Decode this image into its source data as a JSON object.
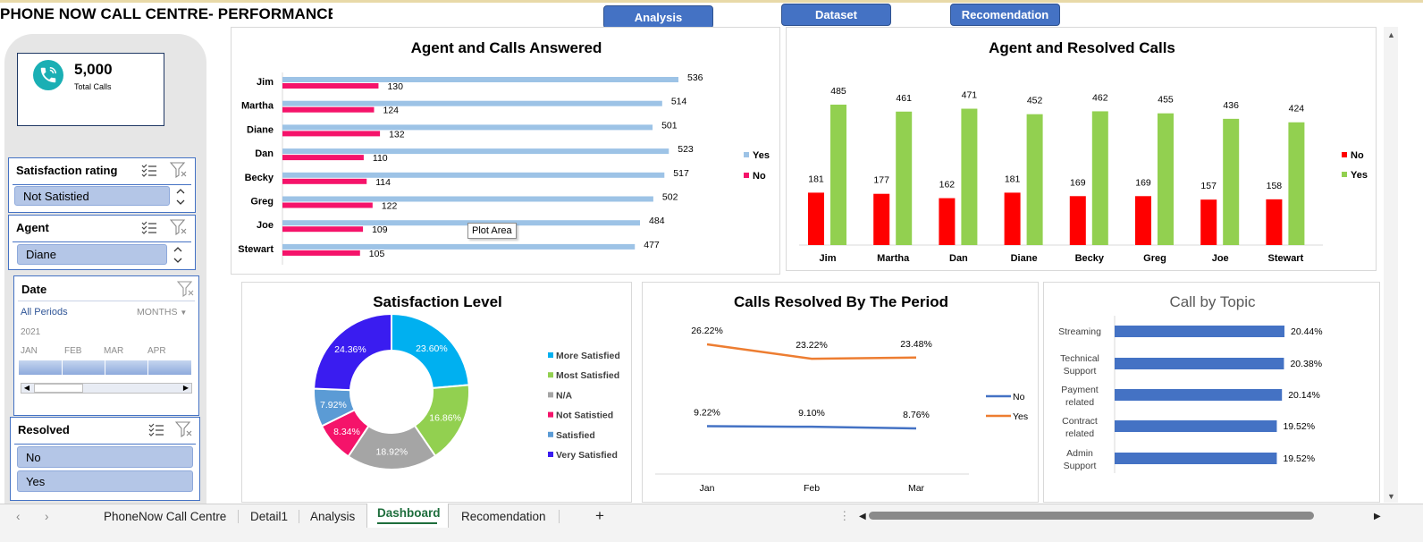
{
  "header": {
    "title": "PHONE NOW CALL CENTRE- PERFORMANCE DAS",
    "nav": {
      "analysis": "Analysis",
      "dataset": "Dataset",
      "recomendation": "Recomendation"
    }
  },
  "kpi": {
    "value": "5,000",
    "label": "Total Calls"
  },
  "slicers": {
    "satisfaction": {
      "title": "Satisfaction rating",
      "selected": "Not Satistied"
    },
    "agent": {
      "title": "Agent",
      "selected": "Diane"
    },
    "date": {
      "title": "Date",
      "period": "All Periods",
      "unit": "MONTHS",
      "year": "2021",
      "months": [
        "JAN",
        "FEB",
        "MAR",
        "APR"
      ]
    },
    "resolved": {
      "title": "Resolved",
      "items": [
        "No",
        "Yes"
      ]
    }
  },
  "tooltip": "Plot Area",
  "colors": {
    "yes_bar": "#9dc3e6",
    "no_bar": "#f5136a",
    "resolved_no": "#ff0000",
    "resolved_yes": "#92d050",
    "line_no": "#4472c4",
    "line_yes": "#ed7d31",
    "topic_bar": "#4472c4",
    "nav_button": "#4472c4"
  },
  "chart_data": [
    {
      "type": "bar",
      "title": "Agent and Calls Answered",
      "categories": [
        "Jim",
        "Martha",
        "Diane",
        "Dan",
        "Becky",
        "Greg",
        "Joe",
        "Stewart"
      ],
      "series": [
        {
          "name": "Yes",
          "values": [
            536,
            514,
            501,
            523,
            517,
            502,
            484,
            477
          ]
        },
        {
          "name": "No",
          "values": [
            130,
            124,
            132,
            110,
            114,
            122,
            109,
            105
          ]
        }
      ],
      "orientation": "horizontal",
      "legend": "right"
    },
    {
      "type": "bar",
      "title": "Agent and Resolved Calls",
      "categories": [
        "Jim",
        "Martha",
        "Dan",
        "Diane",
        "Becky",
        "Greg",
        "Joe",
        "Stewart"
      ],
      "series": [
        {
          "name": "No",
          "values": [
            181,
            177,
            162,
            181,
            169,
            169,
            157,
            158
          ]
        },
        {
          "name": "Yes",
          "values": [
            485,
            461,
            471,
            452,
            462,
            455,
            436,
            424
          ]
        }
      ],
      "orientation": "vertical",
      "legend": "right"
    },
    {
      "type": "pie",
      "title": "Satisfaction Level",
      "donut": true,
      "labels": [
        "More Satisfied",
        "Most Satisfied",
        "N/A",
        "Not Satistied",
        "Satisfied",
        "Very Satisfied"
      ],
      "display": [
        "23.60%",
        "16.86%",
        "18.92%",
        "8.34%",
        "7.92%",
        "24.36%"
      ],
      "values": [
        23.6,
        16.86,
        18.92,
        8.34,
        7.92,
        24.36
      ],
      "colors": [
        "#00b0f0",
        "#92d050",
        "#a5a5a5",
        "#f5136a",
        "#5b9bd5",
        "#3a1cf0"
      ],
      "legend": "right"
    },
    {
      "type": "line",
      "title": "Calls Resolved By The Period",
      "categories": [
        "Jan",
        "Feb",
        "Mar"
      ],
      "series": [
        {
          "name": "No",
          "values": [
            9.22,
            9.1,
            8.76
          ],
          "labels": [
            "9.22%",
            "9.10%",
            "8.76%"
          ]
        },
        {
          "name": "Yes",
          "values": [
            26.22,
            23.22,
            23.48
          ],
          "labels": [
            "26.22%",
            "23.22%",
            "23.48%"
          ]
        }
      ],
      "legend": "right"
    },
    {
      "type": "bar",
      "title": "Call by Topic",
      "categories": [
        "Streaming",
        "Technical Support",
        "Payment related",
        "Contract related",
        "Admin Support"
      ],
      "values": [
        20.44,
        20.38,
        20.14,
        19.52,
        19.52
      ],
      "labels": [
        "20.44%",
        "20.38%",
        "20.14%",
        "19.52%",
        "19.52%"
      ],
      "orientation": "horizontal"
    }
  ],
  "sheet_tabs": [
    "PhoneNow Call Centre",
    "Detail1",
    "Analysis",
    "Dashboard",
    "Recomendation"
  ],
  "active_tab": "Dashboard",
  "add_sheet": "+"
}
